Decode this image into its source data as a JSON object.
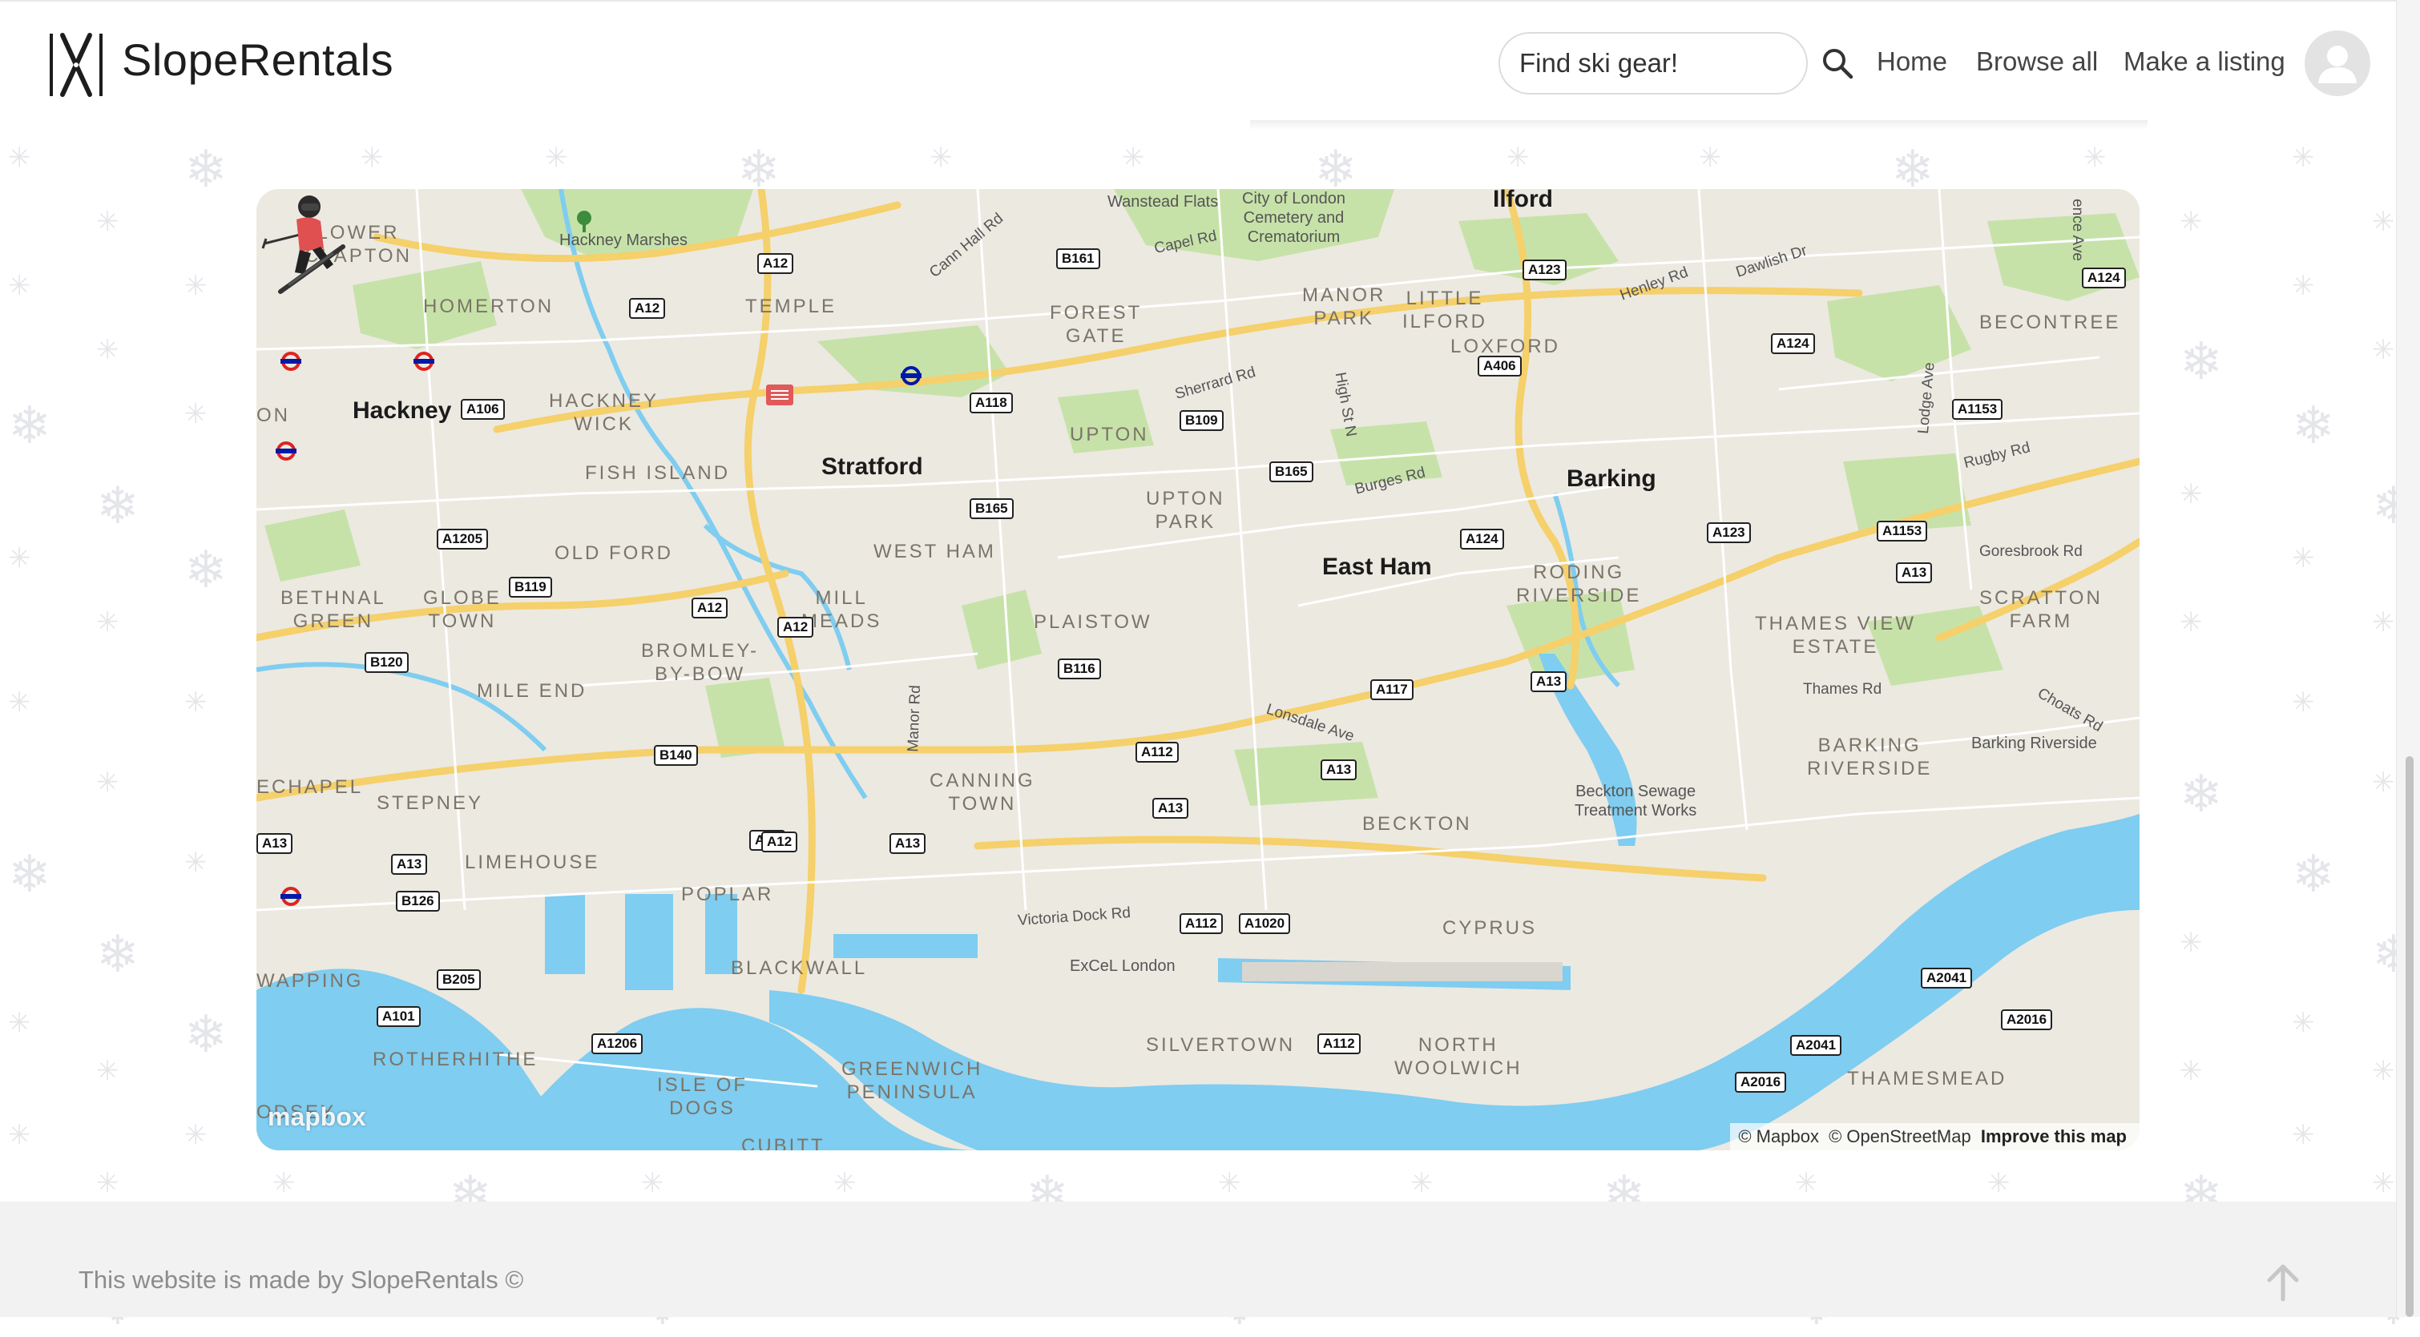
{
  "header": {
    "brand": "SlopeRentals",
    "logo_icon": "crossed-skis-logo",
    "search": {
      "placeholder": "Find ski gear!",
      "icon": "search-icon"
    },
    "nav": [
      {
        "label": "Home"
      },
      {
        "label": "Browse all"
      },
      {
        "label": "Make a listing"
      }
    ],
    "avatar_icon": "user-avatar-icon"
  },
  "map": {
    "marker_icon": "skier-marker-icon",
    "places": [
      "Hackney",
      "Stratford",
      "East Ham",
      "Barking",
      "Ilford"
    ],
    "districts": [
      "LOWER\nCLAPTON",
      "HOMERTON",
      "TEMPLE",
      "HACKNEY\nWICK",
      "FISH ISLAND",
      "FOREST\nGATE",
      "MANOR\nPARK",
      "LITTLE\nILFORD",
      "LOXFORD",
      "BECONTREE",
      "UPTON",
      "UPTON\nPARK",
      "WEST HAM",
      "OLD FORD",
      "BETHNAL\nGREEN",
      "GLOBE\nTOWN",
      "MILL\nMEADS",
      "BROMLEY-\nBY-BOW",
      "MILE END",
      "PLAISTOW",
      "RODING\nRIVERSIDE",
      "THAMES VIEW\nESTATE",
      "SCRATTON\nFARM",
      "BARKING\nRIVERSIDE",
      "CANNING\nTOWN",
      "BECKTON",
      "STEPNEY",
      "LIMEHOUSE",
      "POPLAR",
      "BLACKWALL",
      "CYPRUS",
      "WAPPING",
      "ROTHERHITHE",
      "ISLE OF\nDOGS",
      "GREENWICH\nPENINSULA",
      "SILVERTOWN",
      "NORTH\nWOOLWICH",
      "THAMESMEAD",
      "ECHAPEL",
      "ON",
      "ODSEY",
      "CUBITT"
    ],
    "streets": [
      "Cann Hall Rd",
      "Capel Rd",
      "Sherrard Rd",
      "High St N",
      "Burges Rd",
      "Henley Rd",
      "Dawlish Dr",
      "Lodge Ave",
      "Rugby Rd",
      "Goresbrook Rd",
      "Lonsdale Ave",
      "Manor Rd",
      "Victoria Dock Rd",
      "Thames Rd",
      "Choats Rd",
      "ence Ave"
    ],
    "pois": [
      "Hackney Marshes",
      "Wanstead Flats",
      "City of London\nCemetery and\nCrematorium",
      "Beckton Sewage\nTreatment Works",
      "Barking Riverside",
      "ExCeL London"
    ],
    "roads": [
      "A12",
      "A12",
      "A12",
      "A12",
      "B161",
      "A123",
      "A124",
      "A124",
      "A106",
      "A118",
      "B109",
      "A406",
      "A1153",
      "B165",
      "B165",
      "A124",
      "A123",
      "A1153",
      "A13",
      "A1205",
      "B119",
      "A12",
      "B120",
      "B116",
      "A117",
      "A13",
      "B140",
      "A112",
      "A13",
      "A13",
      "A12",
      "A13",
      "A13",
      "A13",
      "B126",
      "B205",
      "A101",
      "A1206",
      "A112",
      "A1020",
      "A112",
      "A2041",
      "A2016",
      "A2041",
      "A2016"
    ],
    "attribution": {
      "mapbox": "© Mapbox",
      "osm": "© OpenStreetMap",
      "improve": "Improve this map"
    },
    "logo": "mapbox",
    "colors": {
      "water": "#7fcdf0",
      "park": "#c7e2a9",
      "land": "#ece9e1",
      "major_road": "#f5d06b"
    }
  },
  "footer": {
    "text": "This website is made by SlopeRentals ©",
    "to_top_icon": "arrow-up-icon"
  }
}
